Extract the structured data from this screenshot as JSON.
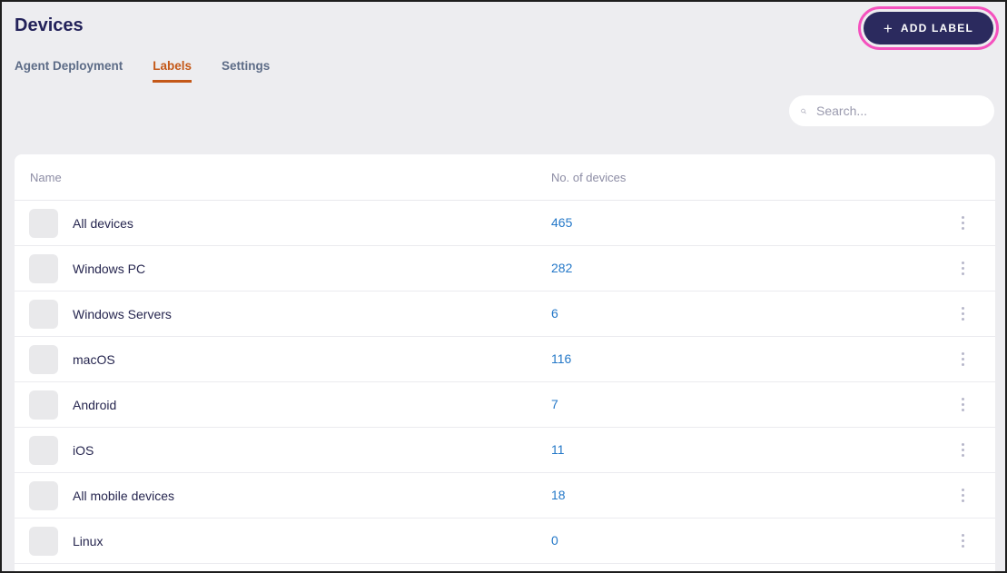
{
  "page": {
    "title": "Devices"
  },
  "tabs": [
    {
      "label": "Agent Deployment"
    },
    {
      "label": "Labels"
    },
    {
      "label": "Settings"
    }
  ],
  "toolbar": {
    "add_label_button": "ADD LABEL",
    "plus_glyph": "+"
  },
  "search": {
    "placeholder": "Search..."
  },
  "table": {
    "columns": [
      "Name",
      "No. of devices"
    ],
    "rows": [
      {
        "name": "All devices",
        "count": "465"
      },
      {
        "name": "Windows PC",
        "count": "282"
      },
      {
        "name": "Windows Servers",
        "count": "6"
      },
      {
        "name": "macOS",
        "count": "116"
      },
      {
        "name": "Android",
        "count": "7"
      },
      {
        "name": "iOS",
        "count": "11"
      },
      {
        "name": "All mobile devices",
        "count": "18"
      },
      {
        "name": "Linux",
        "count": "0"
      }
    ]
  },
  "colors": {
    "active_tab_orange": "#c45818",
    "button_navy": "#2b2a5e",
    "annotation_pink": "#f551be",
    "count_link_blue": "#2478c8",
    "page_background": "#ededf0"
  }
}
